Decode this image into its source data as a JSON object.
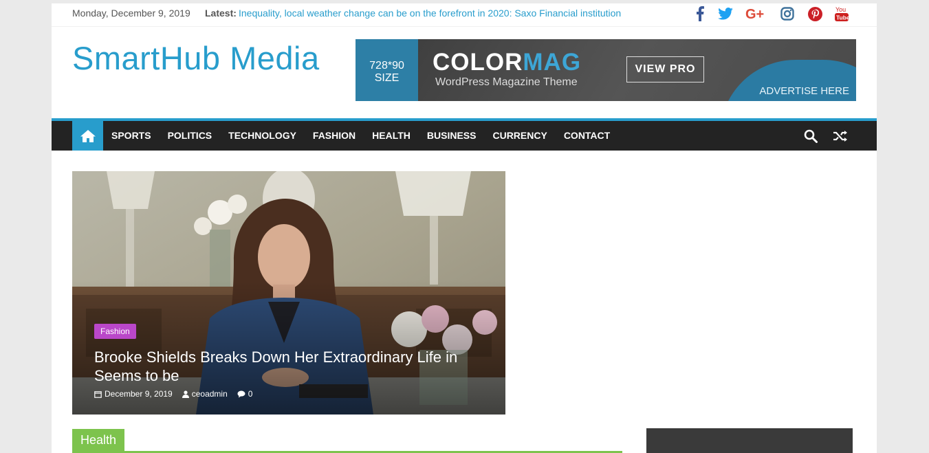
{
  "topbar": {
    "date": "Monday, December 9, 2019",
    "latest_label": "Latest:",
    "latest_link": "Inequality, local weather change can be on the forefront in 2020: Saxo Financial institution",
    "social": [
      {
        "icon": "facebook-icon",
        "color": "#3b5998"
      },
      {
        "icon": "twitter-icon",
        "color": "#1da1f2"
      },
      {
        "icon": "google-plus-icon",
        "color": "#dd4b39"
      },
      {
        "icon": "instagram-icon",
        "color": "#3f729b"
      },
      {
        "icon": "pinterest-icon",
        "color": "#cb2027"
      },
      {
        "icon": "youtube-icon",
        "color": "#cd201f"
      }
    ]
  },
  "header": {
    "site_title": "SmartHub Media",
    "ad": {
      "size_label": "728*90",
      "size_word": "SIZE",
      "brand_a": "COLOR",
      "brand_b": "MAG",
      "subtitle": "WordPress Magazine Theme",
      "button": "VIEW PRO",
      "advertise": "ADVERTISE HERE"
    }
  },
  "nav": {
    "items": [
      "SPORTS",
      "POLITICS",
      "TECHNOLOGY",
      "FASHION",
      "HEALTH",
      "BUSINESS",
      "CURRENCY",
      "CONTACT"
    ],
    "accent": "#289dcc"
  },
  "featured": {
    "category": "Fashion",
    "title": "Brooke Shields Breaks Down Her Extraordinary Life in Seems to be",
    "date": "December 9, 2019",
    "author": "ceoadmin",
    "comments": "0"
  },
  "section": {
    "label": "Health",
    "color": "#7dc34d"
  }
}
